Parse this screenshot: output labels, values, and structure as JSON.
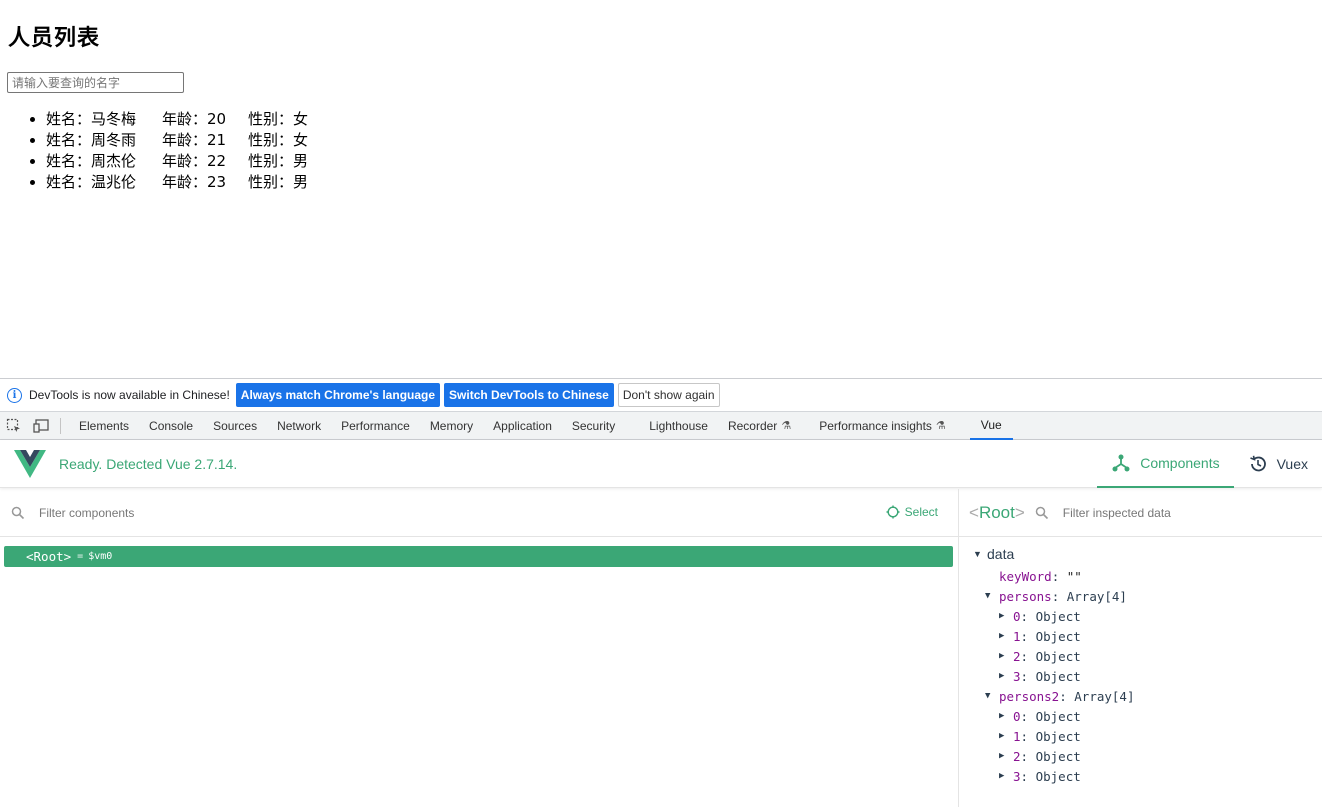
{
  "page": {
    "heading": "人员列表",
    "search_placeholder": "请输入要查询的名字",
    "persons": [
      {
        "name": "姓名：马冬梅",
        "age": "年龄：20",
        "sex": "性别：女"
      },
      {
        "name": "姓名：周冬雨",
        "age": "年龄：21",
        "sex": "性别：女"
      },
      {
        "name": "姓名：周杰伦",
        "age": "年龄：22",
        "sex": "性别：男"
      },
      {
        "name": "姓名：温兆伦",
        "age": "年龄：23",
        "sex": "性别：男"
      }
    ]
  },
  "infobar": {
    "message": "DevTools is now available in Chinese!",
    "btn_match": "Always match Chrome's language",
    "btn_switch": "Switch DevTools to Chinese",
    "btn_dismiss": "Don't show again"
  },
  "tabs": [
    "Elements",
    "Console",
    "Sources",
    "Network",
    "Performance",
    "Memory",
    "Application",
    "Security",
    "Lighthouse",
    "Recorder",
    "Performance insights",
    "Vue"
  ],
  "vue": {
    "status": "Ready. Detected Vue 2.7.14.",
    "nav_components": "Components",
    "nav_vuex": "Vuex",
    "filter_components_placeholder": "Filter components",
    "select_label": "Select",
    "root_tag": "<Root>",
    "root_eq": "=",
    "root_vm": "$vm0",
    "inspector": {
      "root_label": "Root",
      "filter_placeholder": "Filter inspected data",
      "section": "data",
      "keyword_key": "keyWord",
      "keyword_val": "\"\"",
      "persons_key": "persons",
      "persons_val": "Array[4]",
      "persons_items": [
        "0",
        "1",
        "2",
        "3"
      ],
      "persons2_key": "persons2",
      "persons2_val": "Array[4]",
      "persons2_items": [
        "0",
        "1",
        "2",
        "3"
      ],
      "item_type": "Object"
    }
  },
  "colors": {
    "vue_green": "#3ba776",
    "chrome_blue": "#1a73e8",
    "key_purple": "#881391"
  }
}
